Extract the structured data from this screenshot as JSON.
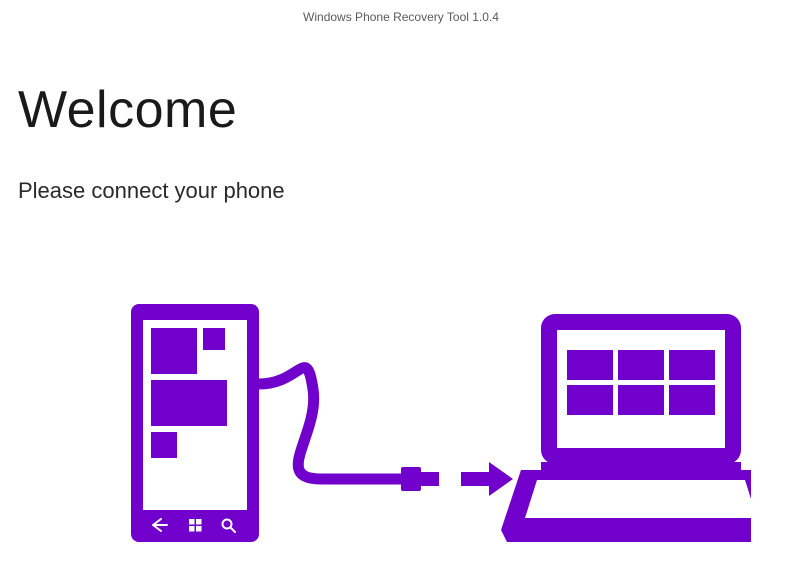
{
  "window": {
    "title": "Windows Phone Recovery Tool 1.0.4"
  },
  "page": {
    "heading": "Welcome",
    "subtitle": "Please connect your phone"
  },
  "illustration": {
    "accent_color": "#7200CC",
    "desc": "phone connected to laptop via USB cable with arrow"
  }
}
